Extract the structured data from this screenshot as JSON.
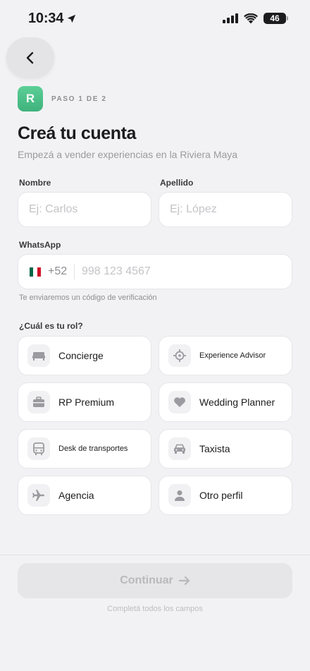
{
  "status_bar": {
    "time": "10:34",
    "battery": "46"
  },
  "header": {
    "logo_letter": "R",
    "step": "PASO 1 DE 2"
  },
  "main": {
    "title": "Creá tu cuenta",
    "subtitle": "Empezá a vender experiencias en la Riviera Maya"
  },
  "form": {
    "nombre": {
      "label": "Nombre",
      "placeholder": "Ej: Carlos",
      "value": ""
    },
    "apellido": {
      "label": "Apellido",
      "placeholder": "Ej: López",
      "value": ""
    },
    "whatsapp": {
      "label": "WhatsApp",
      "country_code": "+52",
      "placeholder": "998 123 4567",
      "value": "",
      "hint": "Te enviaremos un código de verificación"
    }
  },
  "roles": {
    "label": "¿Cuál es tu rol?",
    "items": [
      {
        "label": "Concierge",
        "icon": "bed-icon"
      },
      {
        "label": "Experience Advisor",
        "icon": "target-icon"
      },
      {
        "label": "RP Premium",
        "icon": "briefcase-icon"
      },
      {
        "label": "Wedding Planner",
        "icon": "heart-icon"
      },
      {
        "label": "Desk de transportes",
        "icon": "bus-icon"
      },
      {
        "label": "Taxista",
        "icon": "car-icon"
      },
      {
        "label": "Agencia",
        "icon": "airplane-icon"
      },
      {
        "label": "Otro perfil",
        "icon": "person-icon"
      }
    ]
  },
  "footer": {
    "continue_label": "Continuar",
    "note": "Completá todos los campos"
  },
  "colors": {
    "brand": "#4cc18a",
    "background": "#f2f2f4",
    "card": "#ffffff",
    "disabled": "#e6e6e9"
  }
}
